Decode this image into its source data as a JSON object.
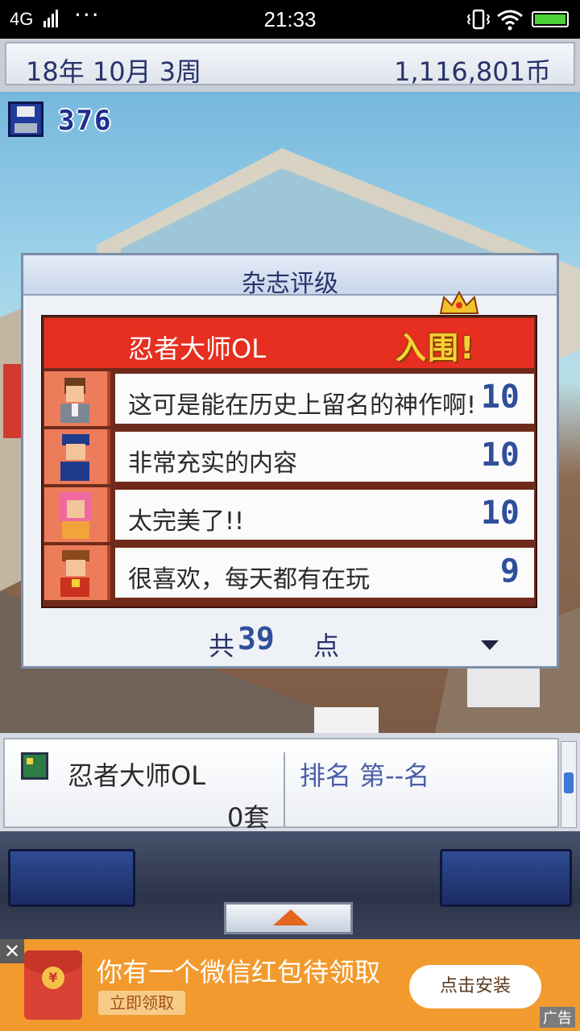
{
  "status_bar": {
    "network": "4G",
    "dots": "···",
    "time": "21:33"
  },
  "top_bar": {
    "date": "18年 10月 3周",
    "money": "1,116,801币"
  },
  "save": {
    "count": "376"
  },
  "dialog": {
    "title": "杂志评级",
    "game_name": "忍者大师OL",
    "badge": "入围!",
    "reviews": [
      {
        "comment": "这可是能在历史上留名的神作啊!",
        "score": "10"
      },
      {
        "comment": "非常充实的内容",
        "score": "10"
      },
      {
        "comment": "太完美了!!",
        "score": "10"
      },
      {
        "comment": "很喜欢，每天都有在玩",
        "score": "9"
      }
    ],
    "total_prefix": "共",
    "total": "39",
    "total_unit": "点"
  },
  "info_panel": {
    "game_name": "忍者大师OL",
    "sets": "0套",
    "rank": "排名 第--名"
  },
  "ad": {
    "close": "✕",
    "title": "你有一个微信红包待领取",
    "subtitle": "立即领取",
    "install": "点击安装",
    "tag": "广告",
    "coin": "¥"
  },
  "colors": {
    "header_red": "#e62f20",
    "badge_yellow": "#f5d136",
    "ad_orange": "#f29a2e",
    "ui_navy": "#27336a"
  }
}
